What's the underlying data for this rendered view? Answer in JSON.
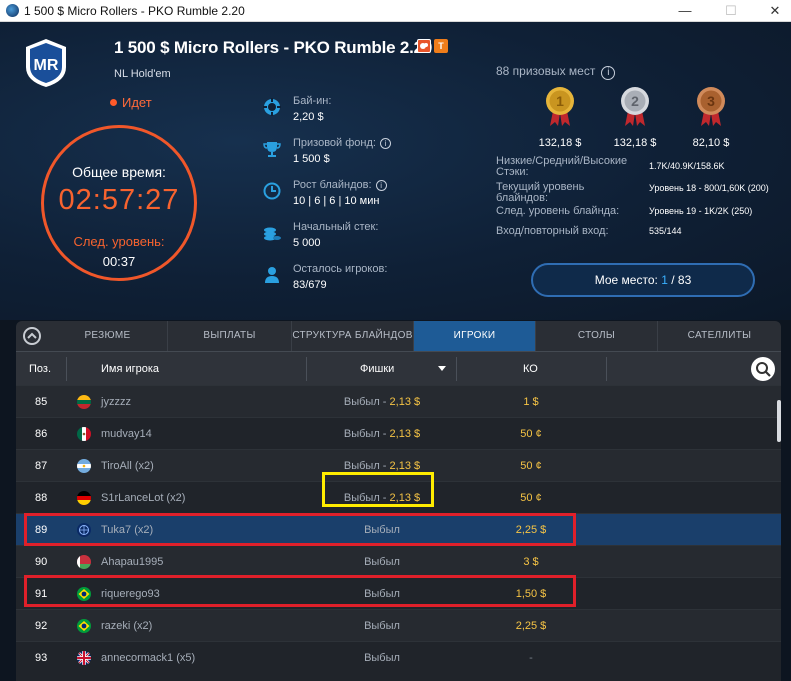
{
  "window": {
    "title": "1 500 $ Micro Rollers - PKO Rumble 2.20",
    "minimize": "—",
    "maximize": "☐",
    "close": "✕"
  },
  "header": {
    "logo_text": "MR",
    "title": "1 500 $ Micro Rollers - PKO Rumble 2.20",
    "subtitle": "NL Hold'em",
    "badge_t": "T",
    "status": "Идет",
    "clock": {
      "label": "Общее время:",
      "time": "02:57:27",
      "next_label": "След. уровень:",
      "next_time": "00:37"
    },
    "info": [
      {
        "key": "Бай-ин:",
        "value": "2,20 $",
        "icon": "chip-icon"
      },
      {
        "key": "Призовой фонд:",
        "value": "1 500 $",
        "icon": "trophy-icon",
        "info": "i"
      },
      {
        "key": "Рост блайндов:",
        "value": "10 | 6 | 6 | 10 мин",
        "icon": "clock-icon",
        "info": "i"
      },
      {
        "key": "Начальный стек:",
        "value": "5 000",
        "icon": "stack-icon"
      },
      {
        "key": "Осталось игроков:",
        "value": "83/679",
        "icon": "player-icon"
      }
    ],
    "prizes": {
      "header": "88 призовых мест",
      "info": "i",
      "medals": [
        {
          "rank": "1",
          "amount": "132,18 $",
          "color": "#e6b53a"
        },
        {
          "rank": "2",
          "amount": "132,18 $",
          "color": "#c9ccd1"
        },
        {
          "rank": "3",
          "amount": "82,10 $",
          "color": "#c97a4a"
        }
      ]
    },
    "stats": [
      {
        "label": "Низкие/Средний/Высокие Стэки:",
        "value": "1.7K/40.9K/158.6K"
      },
      {
        "label": "Текущий уровень блайндов:",
        "value": "Уровень 18 - 800/1,60K (200)"
      },
      {
        "label": "След. уровень блайнда:",
        "value": "Уровень 19 - 1K/2K (250)"
      },
      {
        "label": "Вход/повторный вход:",
        "value": "535/144"
      }
    ],
    "my_place": {
      "label": "Мое место:",
      "rank": "1",
      "sep": "/",
      "total": "83"
    }
  },
  "tabs": [
    {
      "label": "РЕЗЮМЕ",
      "active": false
    },
    {
      "label": "ВЫПЛАТЫ",
      "active": false
    },
    {
      "label": "СТРУКТУРА БЛАЙНДОВ",
      "active": false
    },
    {
      "label": "ИГРОКИ",
      "active": true
    },
    {
      "label": "СТОЛЫ",
      "active": false
    },
    {
      "label": "САТЕЛЛИТЫ",
      "active": false
    }
  ],
  "table": {
    "columns": {
      "pos": "Поз.",
      "name": "Имя игрока",
      "chips": "Фишки",
      "ko": "КО"
    },
    "rows": [
      {
        "pos": "85",
        "flag": "lt",
        "name": "jyzzzz",
        "chips_label": "Выбыл",
        "chips_sep": " - ",
        "chips_value": "2,13 $",
        "ko": "1 $"
      },
      {
        "pos": "86",
        "flag": "mx",
        "name": "mudvay14",
        "chips_label": "Выбыл",
        "chips_sep": " - ",
        "chips_value": "2,13 $",
        "ko": "50 ¢"
      },
      {
        "pos": "87",
        "flag": "ar",
        "name": "TiroAll (x2)",
        "chips_label": "Выбыл",
        "chips_sep": " - ",
        "chips_value": "2,13 $",
        "ko": "50 ¢"
      },
      {
        "pos": "88",
        "flag": "de",
        "name": "S1rLanceLot (x2)",
        "chips_label": "Выбыл",
        "chips_sep": " - ",
        "chips_value": "2,13 $",
        "ko": "50 ¢"
      },
      {
        "pos": "89",
        "flag": "un",
        "name": "Tuka7 (x2)",
        "chips_label": "Выбыл",
        "chips_sep": "",
        "chips_value": "",
        "ko": "2,25 $"
      },
      {
        "pos": "90",
        "flag": "by",
        "name": "Ahapau1995",
        "chips_label": "Выбыл",
        "chips_sep": "",
        "chips_value": "",
        "ko": "3 $"
      },
      {
        "pos": "91",
        "flag": "br",
        "name": "riquerego93",
        "chips_label": "Выбыл",
        "chips_sep": "",
        "chips_value": "",
        "ko": "1,50 $"
      },
      {
        "pos": "92",
        "flag": "br",
        "name": "razeki (x2)",
        "chips_label": "Выбыл",
        "chips_sep": "",
        "chips_value": "",
        "ko": "2,25 $"
      },
      {
        "pos": "93",
        "flag": "gb",
        "name": "annecormack1 (x5)",
        "chips_label": "Выбыл",
        "chips_sep": "",
        "chips_value": "",
        "ko": "-"
      }
    ]
  },
  "colors": {
    "accent_orange": "#f7632f",
    "accent_blue": "#1e5b96",
    "ko_yellow": "#f6c445",
    "highlight_red": "#e0202a",
    "highlight_yellow": "#ffec00"
  }
}
